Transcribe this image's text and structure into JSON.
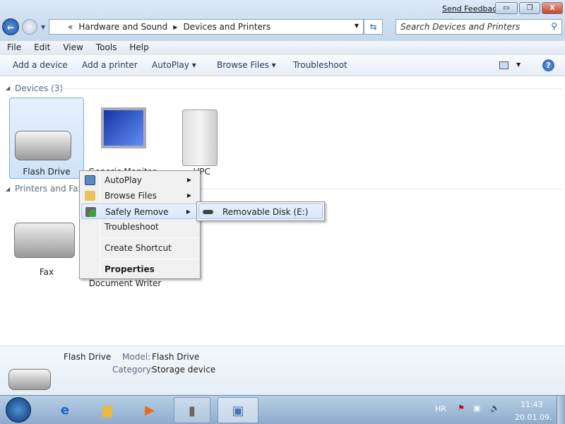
{
  "window": {
    "send_feedback": "Send Feedback",
    "minimize": "▭",
    "restore": "❐",
    "close": "X"
  },
  "nav": {
    "back": "←",
    "address": {
      "overflow": "«",
      "crumbs": [
        "Hardware and Sound",
        "Devices and Printers"
      ]
    },
    "search_placeholder": "Search Devices and Printers"
  },
  "menubar": [
    "File",
    "Edit",
    "View",
    "Tools",
    "Help"
  ],
  "toolbar": {
    "add_device": "Add a device",
    "add_printer": "Add a printer",
    "autoplay": "AutoPlay ▾",
    "browse_files": "Browse Files ▾",
    "troubleshoot": "Troubleshoot"
  },
  "groups": {
    "devices": "Devices (3)",
    "printers": "Printers and Faxes"
  },
  "devices": [
    {
      "label": "Flash Drive",
      "icon": "flash-drive-icon"
    },
    {
      "label": "Generic Monitor",
      "icon": "monitor-icon"
    },
    {
      "label": "VPC",
      "icon": "computer-icon"
    }
  ],
  "printers": [
    {
      "label": "Fax",
      "icon": "fax-icon"
    },
    {
      "label": "Document Writer",
      "icon": "printer-icon"
    }
  ],
  "context_menu": {
    "items": [
      "AutoPlay",
      "Browse Files",
      "Safely Remove",
      "Troubleshoot",
      "Create Shortcut",
      "Properties"
    ],
    "submenu": [
      "Removable Disk (E:)"
    ]
  },
  "details": {
    "name": "Flash Drive",
    "model_label": "Model:",
    "model": "Flash Drive",
    "category_label": "Category:",
    "category": "Storage device"
  },
  "tray": {
    "lang": "HR",
    "time": "11:43",
    "date": "20.01.09."
  }
}
